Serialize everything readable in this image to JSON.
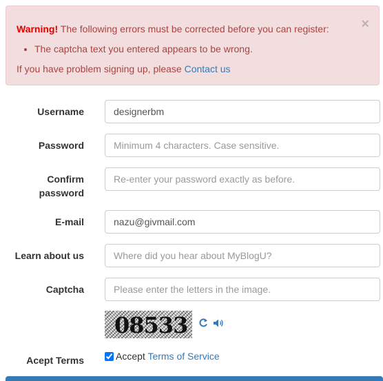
{
  "alert": {
    "warning_label": "Warning!",
    "message": " The following errors must be corrected before you can register:",
    "errors": [
      "The captcha text you entered appears to be wrong."
    ],
    "help_prefix": "If you have problem signing up, please ",
    "contact_link": "Contact us",
    "close_glyph": "×"
  },
  "form": {
    "username": {
      "label": "Username",
      "value": "designerbm",
      "placeholder": ""
    },
    "password": {
      "label": "Password",
      "value": "",
      "placeholder": "Minimum 4 characters. Case sensitive."
    },
    "confirm_password": {
      "label_line1": "Confirm",
      "label_line2": "password",
      "value": "",
      "placeholder": "Re-enter your password exactly as before."
    },
    "email": {
      "label": "E-mail",
      "value": "nazu@givmail.com",
      "placeholder": ""
    },
    "learn_about": {
      "label": "Learn about us",
      "value": "",
      "placeholder": "Where did you hear about MyBlogU?"
    },
    "captcha": {
      "label": "Captcha",
      "value": "",
      "placeholder": "Please enter the letters in the image.",
      "image_text": "08533"
    },
    "terms": {
      "label": "Acept Terms",
      "checked": true,
      "prefix": "Accept ",
      "link": "Terms of Service"
    }
  },
  "icons": {
    "refresh": "refresh-icon",
    "audio": "volume-icon"
  },
  "colors": {
    "alert_bg": "#f2dede",
    "alert_text": "#a94442",
    "warning": "#e00000",
    "link": "#337ab7"
  }
}
